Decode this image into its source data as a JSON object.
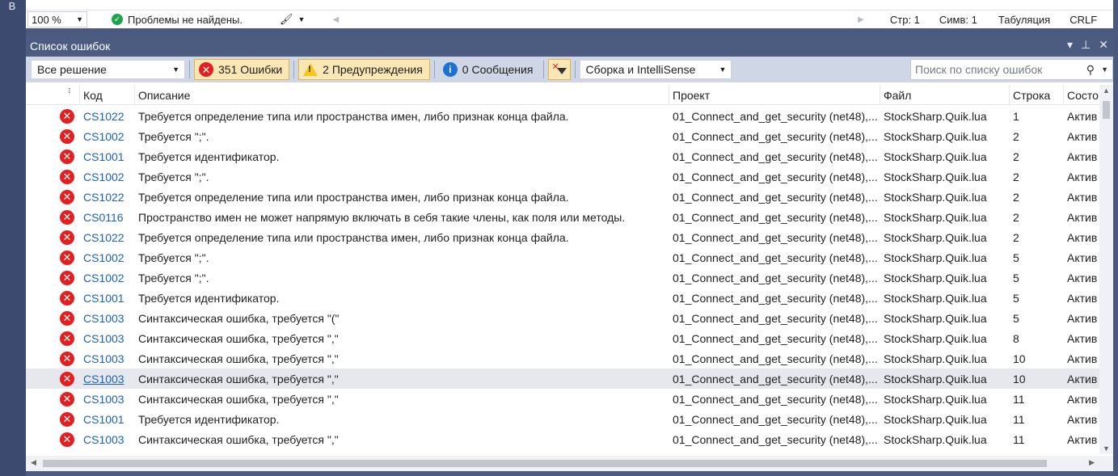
{
  "left_strip": {
    "tab_label": "В"
  },
  "editor": {
    "zoom": "100 %",
    "issues_text": "Проблемы не найдены.",
    "line": "Стр: 1",
    "col": "Симв: 1",
    "tabs": "Табуляция",
    "eol": "CRLF"
  },
  "panel": {
    "title": "Список ошибок",
    "pin_glyph": "▾",
    "dock_glyph": "⊥",
    "close_glyph": "✕"
  },
  "toolbar": {
    "scope": "Все решение",
    "errors_label": "351 Ошибки",
    "warnings_label": "2 Предупреждения",
    "messages_label": "0 Сообщения",
    "build_source": "Сборка и IntelliSense",
    "search_placeholder": "Поиск по списку ошибок"
  },
  "columns": {
    "code": "Код",
    "description": "Описание",
    "project": "Проект",
    "file": "Файл",
    "line": "Строка",
    "state": "Состо"
  },
  "rows": [
    {
      "code": "CS1022",
      "description": "Требуется определение типа или пространства имен, либо признак конца файла.",
      "project": "01_Connect_and_get_security (net48),...",
      "file": "StockSharp.Quik.lua",
      "line": "1",
      "state": "Актив"
    },
    {
      "code": "CS1002",
      "description": "Требуется \";\".",
      "project": "01_Connect_and_get_security (net48),...",
      "file": "StockSharp.Quik.lua",
      "line": "2",
      "state": "Актив"
    },
    {
      "code": "CS1001",
      "description": "Требуется идентификатор.",
      "project": "01_Connect_and_get_security (net48),...",
      "file": "StockSharp.Quik.lua",
      "line": "2",
      "state": "Актив"
    },
    {
      "code": "CS1002",
      "description": "Требуется \";\".",
      "project": "01_Connect_and_get_security (net48),...",
      "file": "StockSharp.Quik.lua",
      "line": "2",
      "state": "Актив"
    },
    {
      "code": "CS1022",
      "description": "Требуется определение типа или пространства имен, либо признак конца файла.",
      "project": "01_Connect_and_get_security (net48),...",
      "file": "StockSharp.Quik.lua",
      "line": "2",
      "state": "Актив"
    },
    {
      "code": "CS0116",
      "description": "Пространство имен не может напрямую включать в себя такие члены, как поля или методы.",
      "project": "01_Connect_and_get_security (net48),...",
      "file": "StockSharp.Quik.lua",
      "line": "2",
      "state": "Актив"
    },
    {
      "code": "CS1022",
      "description": "Требуется определение типа или пространства имен, либо признак конца файла.",
      "project": "01_Connect_and_get_security (net48),...",
      "file": "StockSharp.Quik.lua",
      "line": "2",
      "state": "Актив"
    },
    {
      "code": "CS1002",
      "description": "Требуется \";\".",
      "project": "01_Connect_and_get_security (net48),...",
      "file": "StockSharp.Quik.lua",
      "line": "5",
      "state": "Актив"
    },
    {
      "code": "CS1002",
      "description": "Требуется \";\".",
      "project": "01_Connect_and_get_security (net48),...",
      "file": "StockSharp.Quik.lua",
      "line": "5",
      "state": "Актив"
    },
    {
      "code": "CS1001",
      "description": "Требуется идентификатор.",
      "project": "01_Connect_and_get_security (net48),...",
      "file": "StockSharp.Quik.lua",
      "line": "5",
      "state": "Актив"
    },
    {
      "code": "CS1003",
      "description": "Синтаксическая ошибка, требуется \"(\"",
      "project": "01_Connect_and_get_security (net48),...",
      "file": "StockSharp.Quik.lua",
      "line": "5",
      "state": "Актив"
    },
    {
      "code": "CS1003",
      "description": "Синтаксическая ошибка, требуется \",\"",
      "project": "01_Connect_and_get_security (net48),...",
      "file": "StockSharp.Quik.lua",
      "line": "8",
      "state": "Актив"
    },
    {
      "code": "CS1003",
      "description": "Синтаксическая ошибка, требуется \",\"",
      "project": "01_Connect_and_get_security (net48),...",
      "file": "StockSharp.Quik.lua",
      "line": "10",
      "state": "Актив"
    },
    {
      "code": "CS1003",
      "description": "Синтаксическая ошибка, требуется \",\"",
      "project": "01_Connect_and_get_security (net48),...",
      "file": "StockSharp.Quik.lua",
      "line": "10",
      "state": "Актив",
      "selected": true
    },
    {
      "code": "CS1003",
      "description": "Синтаксическая ошибка, требуется \",\"",
      "project": "01_Connect_and_get_security (net48),...",
      "file": "StockSharp.Quik.lua",
      "line": "11",
      "state": "Актив"
    },
    {
      "code": "CS1001",
      "description": "Требуется идентификатор.",
      "project": "01_Connect_and_get_security (net48),...",
      "file": "StockSharp.Quik.lua",
      "line": "11",
      "state": "Актив"
    },
    {
      "code": "CS1003",
      "description": "Синтаксическая ошибка, требуется \",\"",
      "project": "01_Connect_and_get_security (net48),...",
      "file": "StockSharp.Quik.lua",
      "line": "11",
      "state": "Актив"
    }
  ],
  "icons": {
    "error": "error-icon",
    "warning": "warning-icon",
    "info": "info-icon",
    "ok": "check-circle-icon"
  },
  "colors": {
    "error_red": "#e51f1f",
    "link_blue": "#1a62b8",
    "panel_title_bg": "#4c5b80",
    "toolbar_bg": "#cfd6e5",
    "active_filter_bg": "#fbe7b6"
  }
}
